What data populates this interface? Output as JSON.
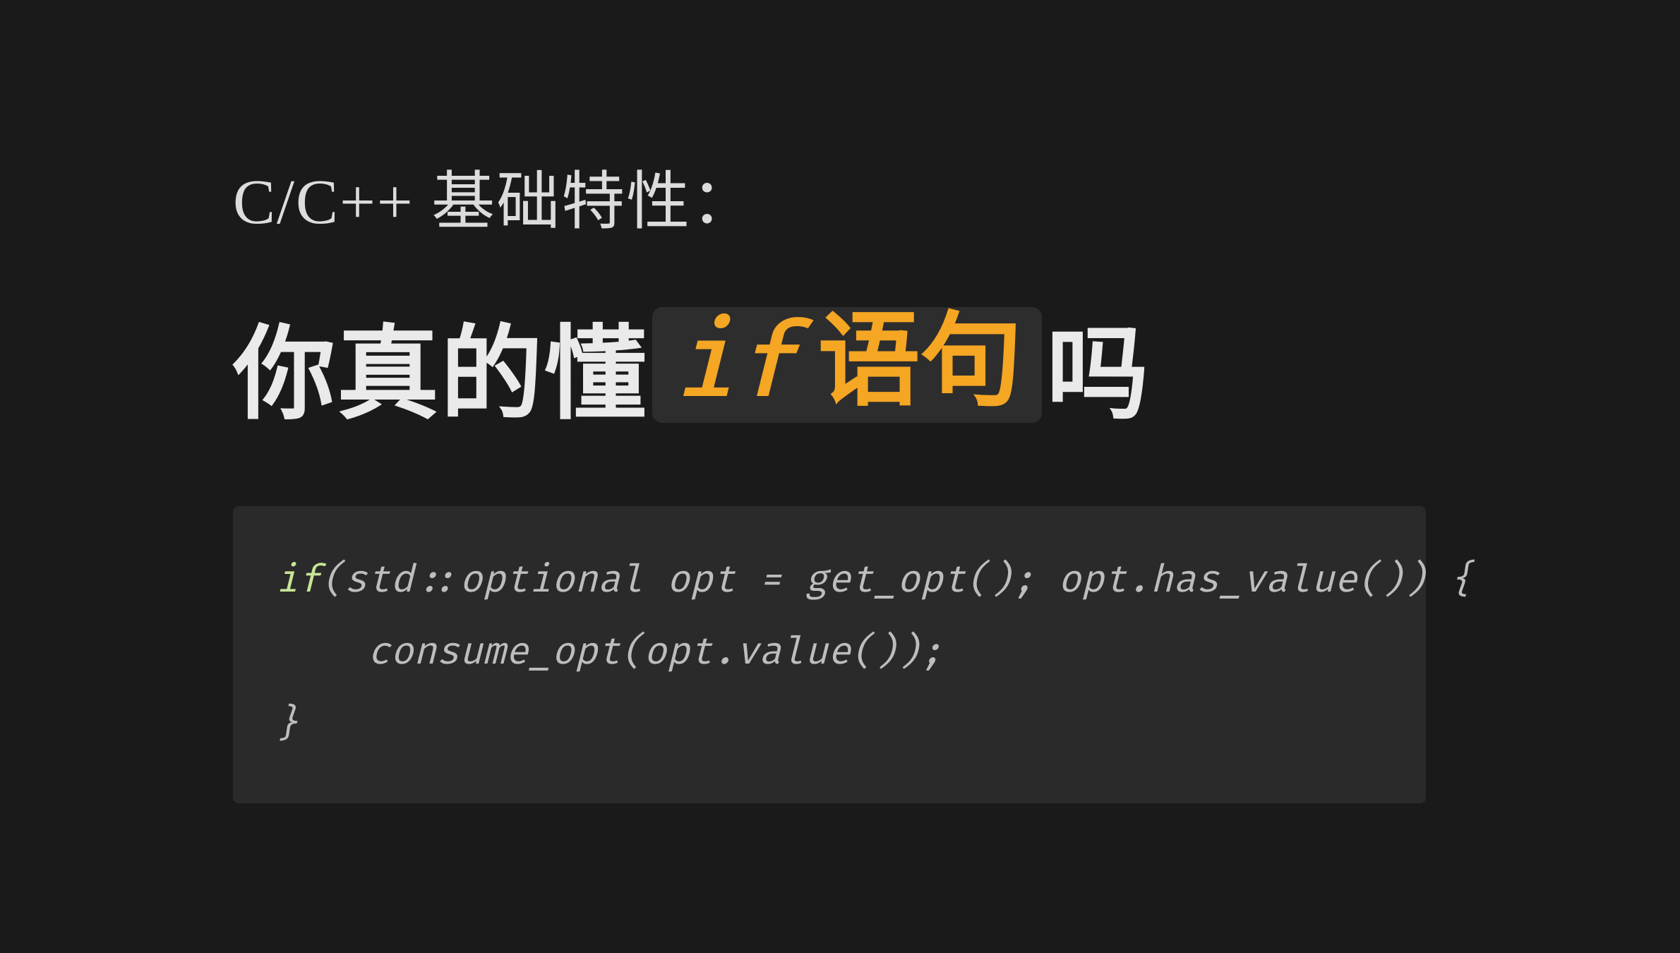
{
  "supertitle": "C/C++ 基础特性：",
  "title": {
    "pre": "你真的懂",
    "hl_code": "if",
    "hl_text": "语句",
    "post": "吗"
  },
  "code": {
    "line1": {
      "t1": "if",
      "t2": "(std::optional opt = get_opt(); opt.has_value()) {"
    },
    "line2": {
      "indent": "    ",
      "t1": "consume_opt(opt.value());"
    },
    "line3": {
      "t1": "}"
    }
  }
}
